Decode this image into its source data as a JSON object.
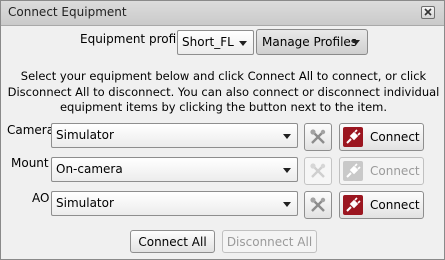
{
  "window": {
    "title": "Connect Equipment"
  },
  "profile": {
    "label": "Equipment profile",
    "selected": "Short_FL",
    "manage_label": "Manage Profiles"
  },
  "description": "Select your equipment below and click Connect All to connect, or click Disconnect All to disconnect. You can also connect or disconnect individual equipment items by clicking the button next to the item.",
  "equipment": [
    {
      "label": "Camera",
      "value": "Simulator",
      "connect_label": "Connect",
      "enabled": true
    },
    {
      "label": "Mount",
      "value": "On-camera",
      "connect_label": "Connect",
      "enabled": false
    },
    {
      "label": "AO",
      "value": "Simulator",
      "connect_label": "Connect",
      "enabled": true
    }
  ],
  "footer": {
    "connect_all_label": "Connect All",
    "disconnect_all_label": "Disconnect All"
  },
  "colors": {
    "plug_active": "#9b1620",
    "plug_inactive": "#c9c9c9"
  }
}
